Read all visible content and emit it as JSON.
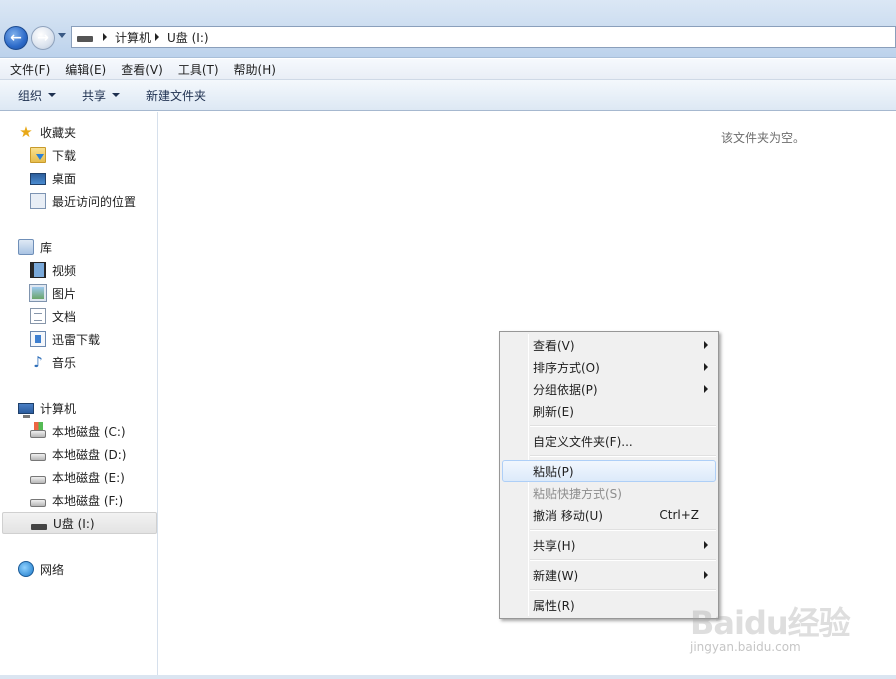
{
  "address": {
    "crumbs": [
      "计算机",
      "U盘 (I:)"
    ]
  },
  "menubar": {
    "items": [
      "文件(F)",
      "编辑(E)",
      "查看(V)",
      "工具(T)",
      "帮助(H)"
    ]
  },
  "toolbar": {
    "organize": "组织",
    "share": "共享",
    "new_folder": "新建文件夹"
  },
  "navpane": {
    "favorites": {
      "label": "收藏夹",
      "items": [
        "下载",
        "桌面",
        "最近访问的位置"
      ]
    },
    "libraries": {
      "label": "库",
      "items": [
        "视频",
        "图片",
        "文档",
        "迅雷下载",
        "音乐"
      ]
    },
    "computer": {
      "label": "计算机",
      "items": [
        "本地磁盘 (C:)",
        "本地磁盘 (D:)",
        "本地磁盘 (E:)",
        "本地磁盘 (F:)",
        "U盘 (I:)"
      ]
    },
    "network": {
      "label": "网络"
    }
  },
  "content": {
    "empty_message": "该文件夹为空。"
  },
  "context_menu": {
    "items": [
      {
        "label": "查看(V)",
        "submenu": true
      },
      {
        "label": "排序方式(O)",
        "submenu": true
      },
      {
        "label": "分组依据(P)",
        "submenu": true
      },
      {
        "label": "刷新(E)"
      },
      {
        "label": "自定义文件夹(F)..."
      },
      {
        "label": "粘贴(P)",
        "highlighted": true
      },
      {
        "label": "粘贴快捷方式(S)",
        "disabled": true
      },
      {
        "label": "撤消 移动(U)",
        "shortcut": "Ctrl+Z"
      },
      {
        "label": "共享(H)",
        "submenu": true
      },
      {
        "label": "新建(W)",
        "submenu": true
      },
      {
        "label": "属性(R)"
      }
    ]
  },
  "watermark": {
    "logo": "Baidu经验",
    "url": "jingyan.baidu.com"
  },
  "colors": {
    "accent": "#2d6bc9",
    "menu_highlight": "#dceafa"
  }
}
